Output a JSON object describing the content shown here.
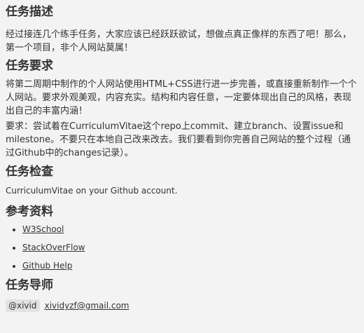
{
  "sections": [
    {
      "title": "任务描述"
    },
    {
      "title": "任务要求"
    },
    {
      "title": "任务检查"
    },
    {
      "title": "参考资料"
    },
    {
      "title": "任务导师"
    }
  ],
  "description": "经过接连几个练手任务，大家应该已经跃跃欲试，想做点真正像样的东西了吧！那么，第一个项目，非个人网站莫属！",
  "requirements": {
    "p1": "将第二周期中制作的个人网站使用HTML+CSS进行进一步完善，或直接重新制作一个个人网站。要求外观美观，内容充实。结构和内容任意，一定要体现出自己的风格，表现出自己的丰富内涵！",
    "p2": "要求：尝试着在CurriculumVitae这个repo上commit、建立branch、设置issue和milestone。不要只在本地自己改来改去。我们要看到你完善自己网站的整个过程（通过Github中的changes记录）。"
  },
  "check": "CurriculumVitae on your Github account.",
  "references": [
    {
      "label": "W3School"
    },
    {
      "label": "StackOverFlow"
    },
    {
      "label": "Github Help"
    }
  ],
  "mentor": {
    "handle": "@xivid",
    "email": "xividyzf@gmail.com"
  }
}
